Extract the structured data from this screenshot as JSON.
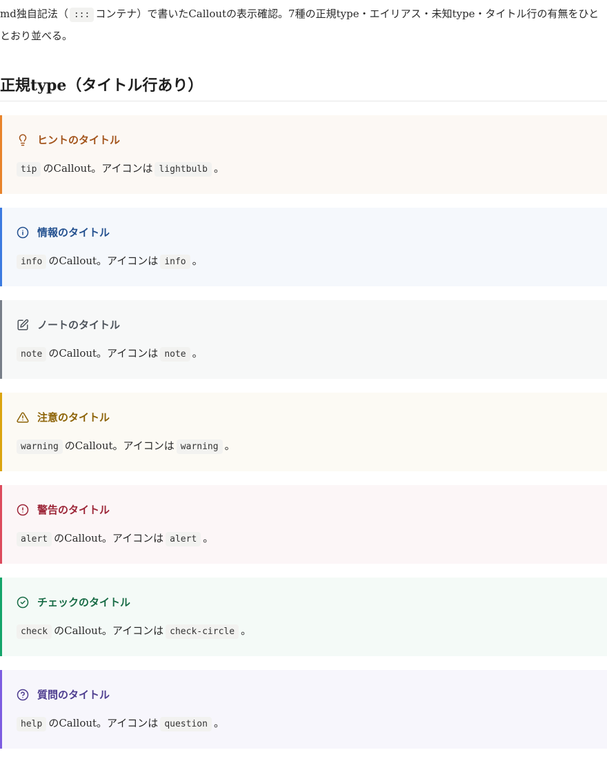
{
  "intro": {
    "before": "md独自記法（",
    "code": ":::",
    "after": "コンテナ）で書いたCalloutの表示確認。7種の正規type・エイリアス・未知type・タイトル行の有無をひととおり並べる。"
  },
  "section": {
    "heading": "正規type（タイトル行あり）"
  },
  "colors": {
    "tip": "#e8832a",
    "info": "#3b7ae0",
    "note": "#777e88",
    "warning": "#dba40e",
    "alert": "#dc4a5c",
    "check": "#13a46a",
    "help": "#7c5ce0"
  },
  "callouts": [
    {
      "title": "ヒントのタイトル",
      "type_code": "tip",
      "mid": "のCallout。アイコンは",
      "icon_code": "lightbulb",
      "end": "。",
      "icon": "lightbulb-icon"
    },
    {
      "title": "情報のタイトル",
      "type_code": "info",
      "mid": "のCallout。アイコンは",
      "icon_code": "info",
      "end": "。",
      "icon": "info-icon"
    },
    {
      "title": "ノートのタイトル",
      "type_code": "note",
      "mid": "のCallout。アイコンは",
      "icon_code": "note",
      "end": "。",
      "icon": "note-icon"
    },
    {
      "title": "注意のタイトル",
      "type_code": "warning",
      "mid": "のCallout。アイコンは",
      "icon_code": "warning",
      "end": "。",
      "icon": "warning-icon"
    },
    {
      "title": "警告のタイトル",
      "type_code": "alert",
      "mid": "のCallout。アイコンは",
      "icon_code": "alert",
      "end": "。",
      "icon": "alert-icon"
    },
    {
      "title": "チェックのタイトル",
      "type_code": "check",
      "mid": "のCallout。アイコンは",
      "icon_code": "check-circle",
      "end": "。",
      "icon": "check-circle-icon"
    },
    {
      "title": "質問のタイトル",
      "type_code": "help",
      "mid": "のCallout。アイコンは",
      "icon_code": "question",
      "end": "。",
      "icon": "question-icon"
    }
  ]
}
